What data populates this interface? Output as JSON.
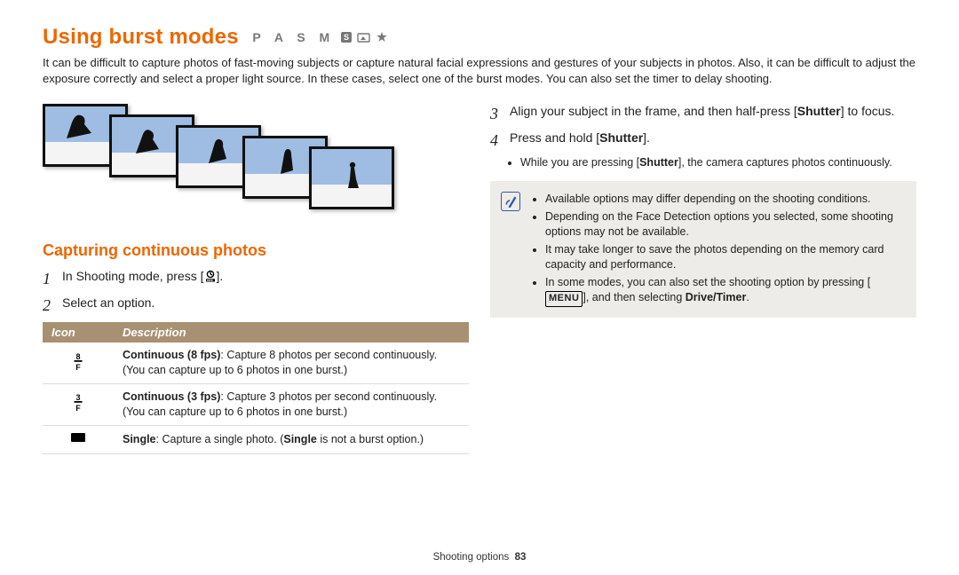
{
  "header": {
    "title": "Using burst modes",
    "modes_letters": "P A S M"
  },
  "intro": "It can be difficult to capture photos of fast-moving subjects or capture natural facial expressions and gestures of your subjects in photos. Also, it can be difficult to adjust the exposure correctly and select a proper light source. In these cases, select one of the burst modes. You can also set the timer to delay shooting.",
  "left": {
    "subhead": "Capturing continuous photos",
    "step1_pre": "In Shooting mode, press [",
    "step1_post": "].",
    "step2": "Select an option.",
    "table": {
      "col_icon": "Icon",
      "col_desc": "Description",
      "row1": {
        "b": "Continuous (8 fps)",
        "t": ": Capture 8 photos per second continuously.",
        "p": "(You can capture up to 6 photos in one burst.)",
        "icon_top": "8",
        "icon_bot": "F"
      },
      "row2": {
        "b": "Continuous (3 fps)",
        "t": ": Capture 3 photos per second continuously.",
        "p": "(You can capture up to 6 photos in one burst.)",
        "icon_top": "3",
        "icon_bot": "F"
      },
      "row3": {
        "b1": "Single",
        "t1": ": Capture a single photo. (",
        "b2": "Single",
        "t2": " is not a burst option.)"
      }
    }
  },
  "right": {
    "step3_pre": "Align your subject in the frame, and then half-press [",
    "step3_b": "Shutter",
    "step3_post": "] to focus.",
    "step4_pre": "Press and hold [",
    "step4_b": "Shutter",
    "step4_post": "].",
    "sub_pre": "While you are pressing [",
    "sub_b": "Shutter",
    "sub_post": "], the camera captures photos continuously.",
    "notes": {
      "n1": "Available options may differ depending on the shooting conditions.",
      "n2": "Depending on the Face Detection options you selected, some shooting options may not be available.",
      "n3": "It may take longer to save the photos depending on the memory card capacity and performance.",
      "n4_pre": "In some modes, you can also set the shooting option by pressing [",
      "n4_menu": "MENU",
      "n4_mid": "], and then selecting ",
      "n4_b": "Drive/Timer",
      "n4_post": "."
    }
  },
  "footer": {
    "section": "Shooting options",
    "page": "83"
  }
}
